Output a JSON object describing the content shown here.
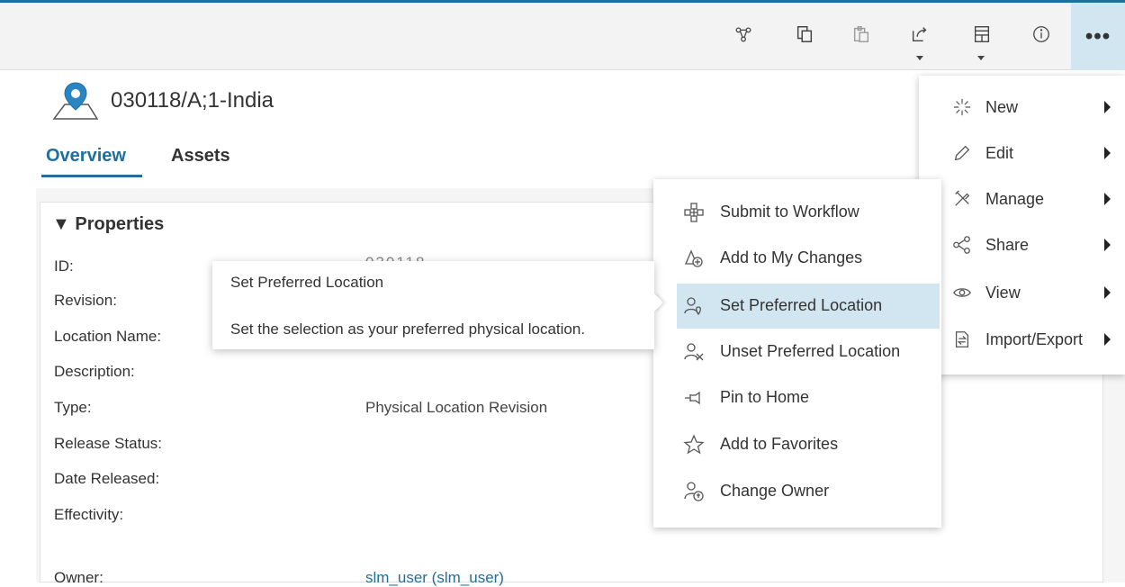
{
  "toolbar": {
    "icons": [
      "tree-structure-icon",
      "copy-icon",
      "paste-icon",
      "share-export-icon",
      "layout-icon",
      "info-icon",
      "more-icon"
    ],
    "more_label": "•••"
  },
  "page": {
    "title": "030118/A;1-India",
    "tabs": [
      {
        "label": "Overview",
        "active": true
      },
      {
        "label": "Assets",
        "active": false
      }
    ]
  },
  "properties": {
    "section_title": "▼ Properties",
    "rows": [
      {
        "label": "ID:",
        "value": "030118"
      },
      {
        "label": "Revision:",
        "value": ""
      },
      {
        "label": "Location Name:",
        "value": ""
      },
      {
        "label": "Description:",
        "value": ""
      },
      {
        "label": "Type:",
        "value": "Physical Location Revision"
      },
      {
        "label": "Release Status:",
        "value": ""
      },
      {
        "label": "Date Released:",
        "value": ""
      },
      {
        "label": "Effectivity:",
        "value": ""
      },
      {
        "label": "Owner:",
        "value": "slm_user (slm_user)"
      }
    ]
  },
  "main_menu": {
    "items": [
      {
        "label": "New",
        "icon": "sparkle-icon"
      },
      {
        "label": "Edit",
        "icon": "pencil-icon"
      },
      {
        "label": "Manage",
        "icon": "tools-icon"
      },
      {
        "label": "Share",
        "icon": "share-icon"
      },
      {
        "label": "View",
        "icon": "eye-icon"
      },
      {
        "label": "Import/Export",
        "icon": "import-export-icon"
      }
    ]
  },
  "sub_menu": {
    "items": [
      {
        "label": "Submit to Workflow",
        "icon": "workflow-icon"
      },
      {
        "label": "Add to My Changes",
        "icon": "add-changes-icon"
      },
      {
        "label": "Set Preferred Location",
        "icon": "set-location-icon",
        "highlighted": true
      },
      {
        "label": "Unset Preferred Location",
        "icon": "unset-location-icon"
      },
      {
        "label": "Pin to Home",
        "icon": "pin-icon"
      },
      {
        "label": "Add to Favorites",
        "icon": "star-icon"
      },
      {
        "label": "Change Owner",
        "icon": "change-owner-icon"
      }
    ]
  },
  "tooltip": {
    "title": "Set Preferred Location",
    "body": "Set the selection as your preferred physical location."
  },
  "colors": {
    "accent": "#1f6f9e",
    "highlight": "#d2e6f1",
    "toolbar_bg": "#f3f3f3"
  }
}
